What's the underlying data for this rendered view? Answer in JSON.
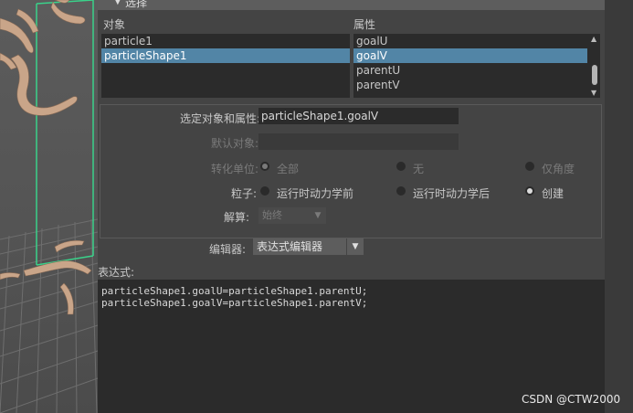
{
  "header": {
    "title": "选择"
  },
  "objects": {
    "label": "对象",
    "items": [
      "particle1",
      "particleShape1"
    ],
    "selected": 1
  },
  "attributes": {
    "label": "属性",
    "items": [
      "goalU",
      "goalV",
      "parentU",
      "parentV"
    ],
    "selected": 1
  },
  "selected_object_attr": {
    "label": "选定对象和属性:",
    "value": "particleShape1.goalV"
  },
  "default_object": {
    "label": "默认对象:",
    "value": ""
  },
  "convert_units": {
    "label": "转化单位:",
    "options": [
      "全部",
      "无",
      "仅角度"
    ],
    "selected": 0
  },
  "particle": {
    "label": "粒子:",
    "options": [
      "运行时动力学前",
      "运行时动力学后",
      "创建"
    ],
    "selected": 2
  },
  "evaluation": {
    "label": "解算:",
    "value": "始终"
  },
  "editor": {
    "label": "编辑器:",
    "value": "表达式编辑器"
  },
  "expression": {
    "label": "表达式:",
    "lines": [
      "particleShape1.goalU=particleShape1.parentU;",
      "particleShape1.goalV=particleShape1.parentV;"
    ]
  },
  "watermark": "CSDN @CTW2000",
  "colors": {
    "selection": "#5285a6",
    "panel": "#444444",
    "field": "#2b2b2b",
    "viewport_grid": "#6f6f6f",
    "selection_wire": "#3ad28a",
    "model": "#caa58a"
  },
  "icons": [
    "triangle-down-icon",
    "scroll-up-icon",
    "scroll-down-icon",
    "dropdown-arrow-icon"
  ]
}
